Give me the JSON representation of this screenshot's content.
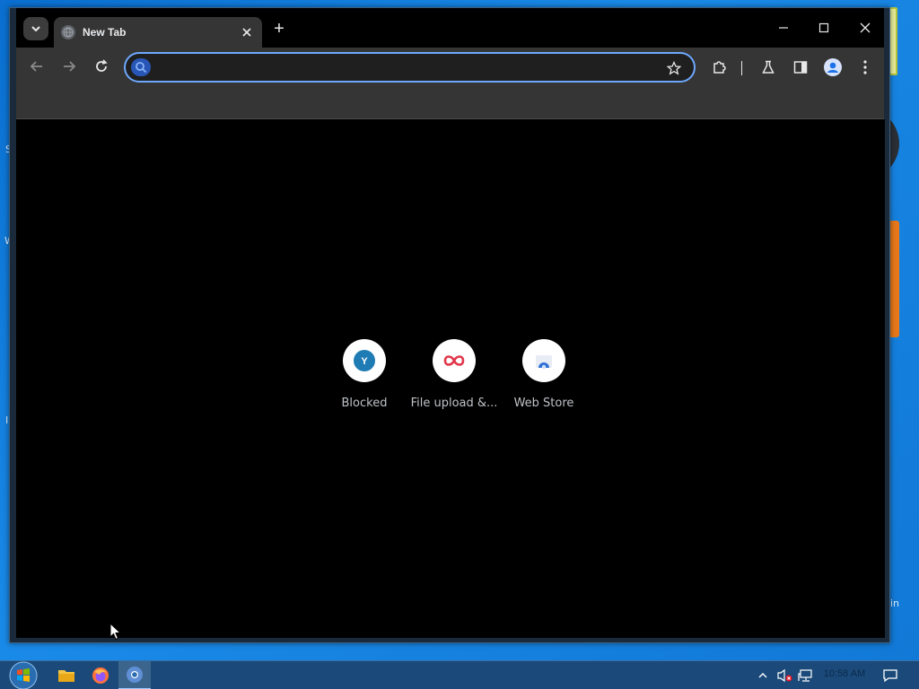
{
  "desktop": {
    "edge_labels": [
      "S",
      "W",
      "I",
      "in"
    ]
  },
  "browser": {
    "tab": {
      "title": "New Tab",
      "favicon_icon": "globe-icon",
      "close_icon": "close-icon"
    },
    "tab_search_icon": "chevron-down-icon",
    "new_tab_label": "+",
    "window_controls": [
      "minimize-icon",
      "maximize-icon",
      "close-icon"
    ],
    "toolbar": {
      "back_icon": "back-arrow-icon",
      "forward_icon": "forward-arrow-icon",
      "reload_icon": "reload-icon",
      "omnibox": {
        "value": "",
        "placeholder": "",
        "search_icon": "search-icon",
        "bookmark_icon": "star-icon"
      },
      "extensions_icon": "puzzle-icon",
      "labs_icon": "flask-icon",
      "side_panel_icon": "side-panel-icon",
      "profile_icon": "profile-avatar-icon",
      "menu_icon": "kebab-menu-icon"
    },
    "shortcuts": [
      {
        "label": "Blocked",
        "icon": "y-letter-icon",
        "letter": "Y"
      },
      {
        "label": "File upload &...",
        "icon": "red-loop-icon"
      },
      {
        "label": "Web Store",
        "icon": "web-store-icon"
      }
    ]
  },
  "taskbar": {
    "start_icon": "windows-start-icon",
    "apps": [
      {
        "name": "file-explorer-icon"
      },
      {
        "name": "firefox-icon"
      },
      {
        "name": "chrome-icon",
        "active": true
      }
    ],
    "tray": {
      "show_hidden_icon": "chevron-up-icon",
      "volume_icon": "volume-muted-icon",
      "network_icon": "network-icon",
      "clock": "10:58 AM",
      "notifications_icon": "notification-icon"
    }
  },
  "colors": {
    "omnibox_border": "#6ea8fe",
    "toolbar_bg": "#353535",
    "content_bg": "#000000",
    "taskbar_bg": "#1b4a7a"
  }
}
